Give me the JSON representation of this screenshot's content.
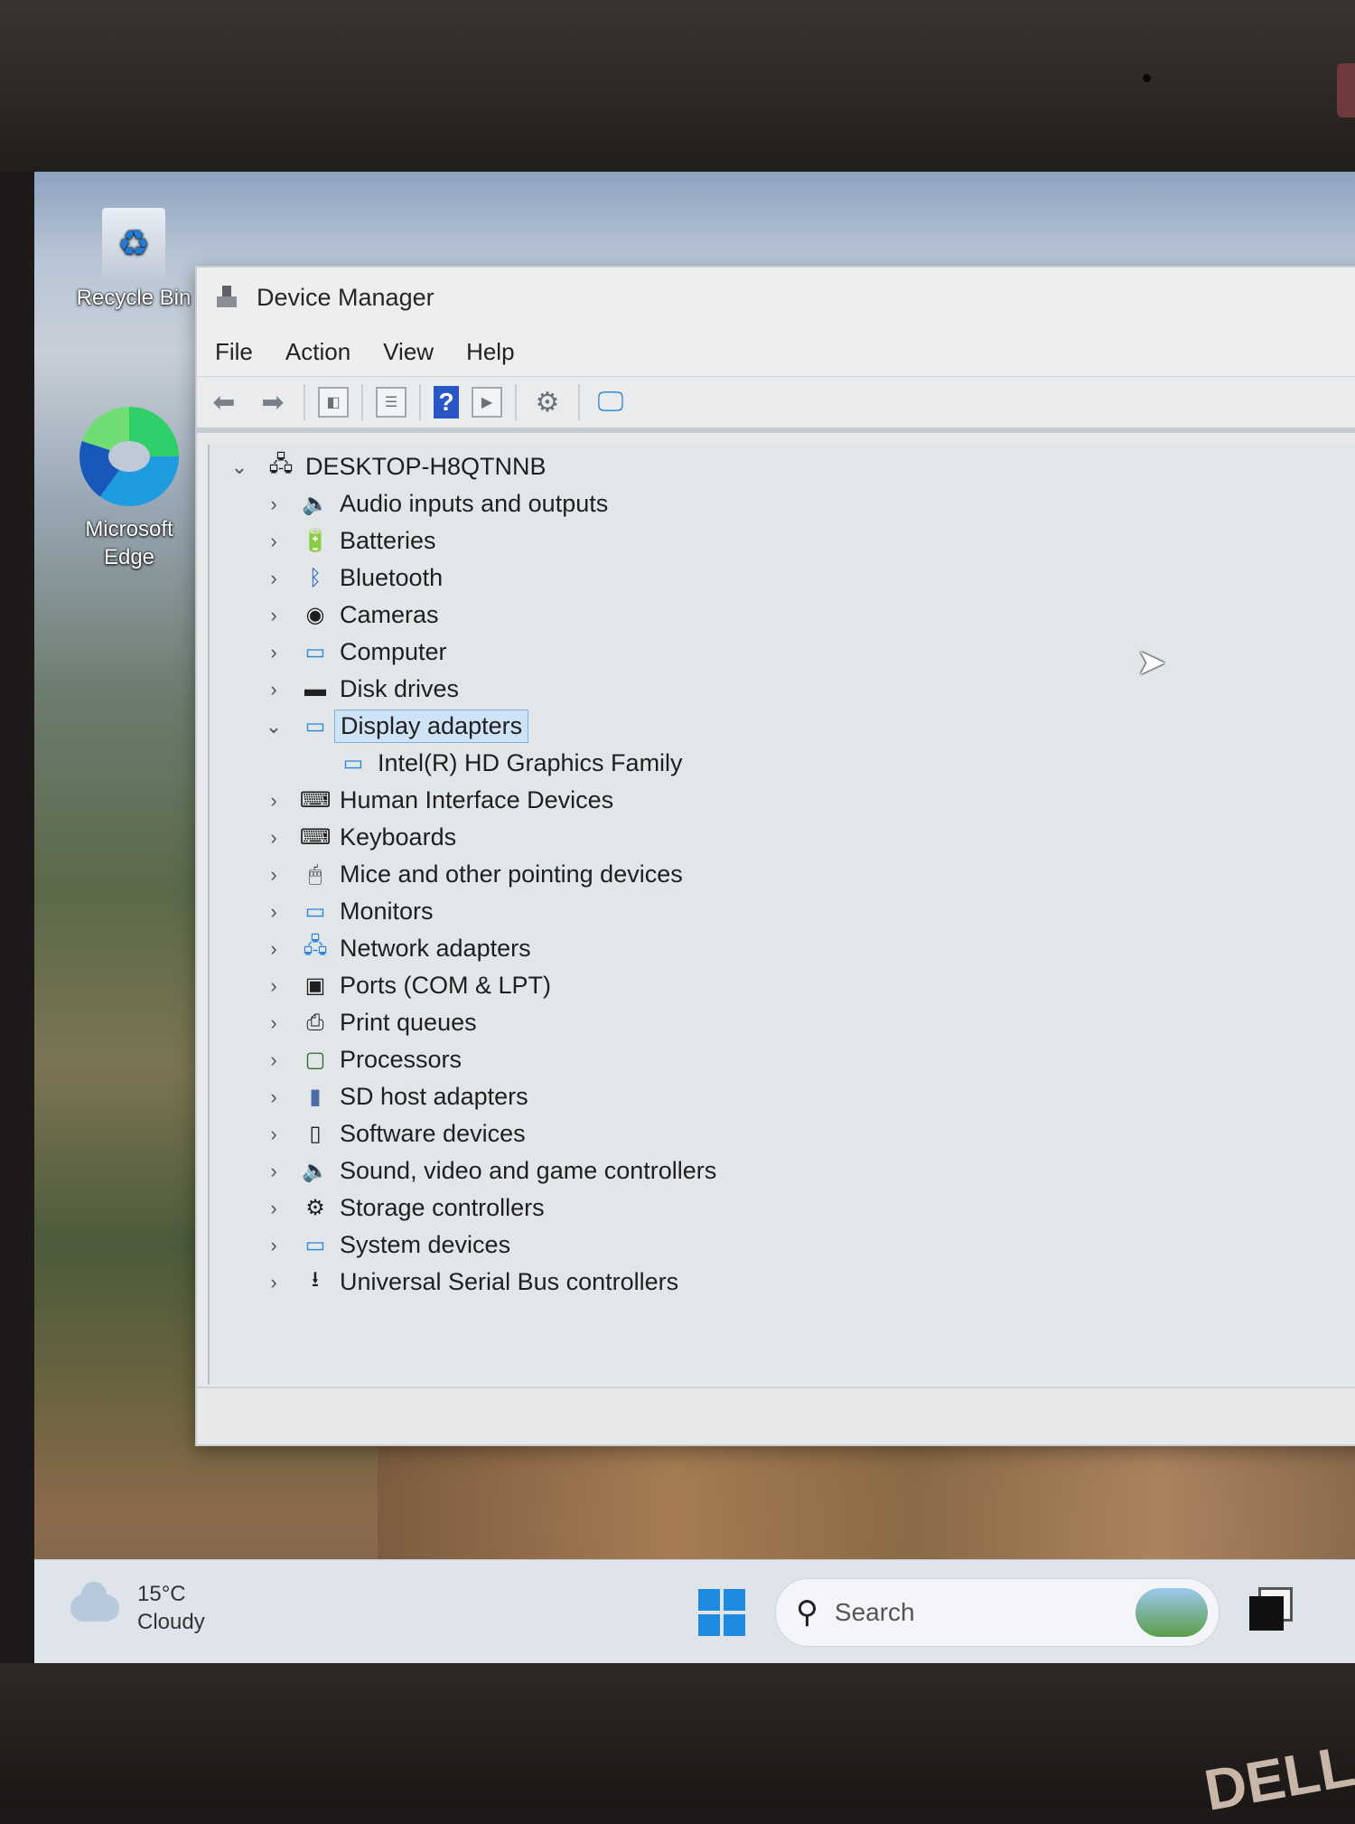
{
  "desktop": {
    "icons": [
      {
        "label": "Recycle Bin"
      },
      {
        "label": "Microsoft Edge"
      }
    ]
  },
  "window": {
    "title": "Device Manager",
    "menu": [
      "File",
      "Action",
      "View",
      "Help"
    ],
    "tree": {
      "root": "DESKTOP-H8QTNNB",
      "categories": [
        "Audio inputs and outputs",
        "Batteries",
        "Bluetooth",
        "Cameras",
        "Computer",
        "Disk drives",
        "Display adapters",
        "Human Interface Devices",
        "Keyboards",
        "Mice and other pointing devices",
        "Monitors",
        "Network adapters",
        "Ports (COM & LPT)",
        "Print queues",
        "Processors",
        "SD host adapters",
        "Software devices",
        "Sound, video and game controllers",
        "Storage controllers",
        "System devices",
        "Universal Serial Bus controllers"
      ],
      "expanded_child": "Intel(R) HD Graphics Family"
    }
  },
  "taskbar": {
    "temperature": "15°C",
    "condition": "Cloudy",
    "search_placeholder": "Search"
  },
  "bezel": {
    "brand": "DELL"
  }
}
